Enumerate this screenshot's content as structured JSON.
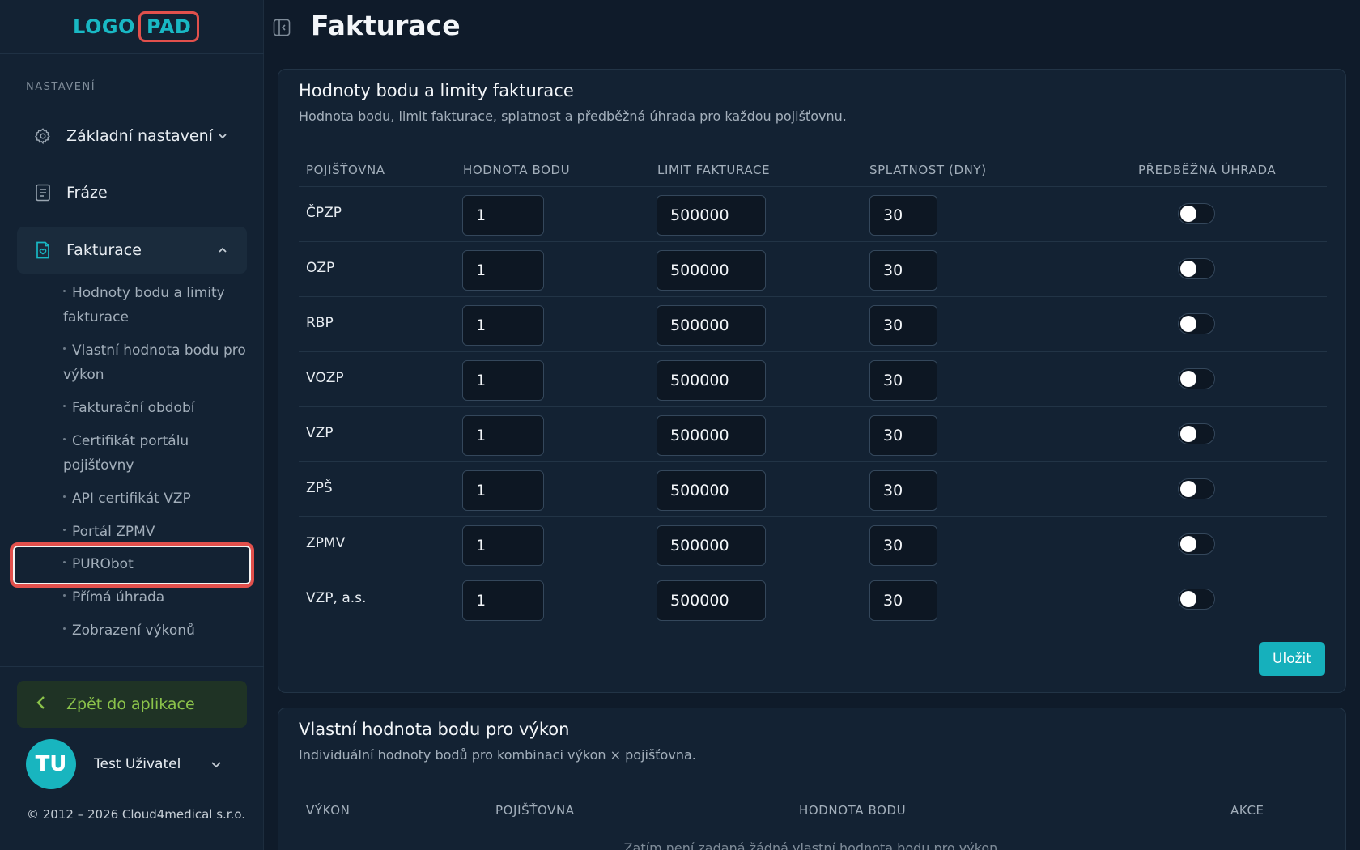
{
  "logo": {
    "left": "LOGO",
    "right": "PAD"
  },
  "sidebar": {
    "section_label": "NASTAVENÍ",
    "items": [
      {
        "label": "Základní nastavení",
        "icon": "gear-icon"
      },
      {
        "label": "Fráze",
        "icon": "document-icon"
      },
      {
        "label": "Fakturace",
        "icon": "invoice-icon"
      }
    ],
    "subitems": [
      "Hodnoty bodu a limity fakturace",
      "Vlastní hodnota bodu pro výkon",
      "Fakturační období",
      "Certifikát portálu pojišťovny",
      "API certifikát VZP",
      "Portál ZPMV",
      "PURObot",
      "Přímá úhrada",
      "Zobrazení výkonů"
    ],
    "back_label": "Zpět do aplikace",
    "user": {
      "initials": "TU",
      "name": "Test Uživatel"
    },
    "copyright": "© 2012 – 2026 Cloud4medical s.r.o."
  },
  "header": {
    "title": "Fakturace"
  },
  "card1": {
    "title": "Hodnoty bodu a limity fakturace",
    "subtitle": "Hodnota bodu, limit fakturace, splatnost a předběžná úhrada pro každou pojišťovnu.",
    "columns": [
      "POJIŠŤOVNA",
      "HODNOTA BODU",
      "LIMIT FAKTURACE",
      "SPLATNOST (DNY)",
      "PŘEDBĚŽNÁ ÚHRADA"
    ],
    "rows": [
      {
        "name": "ČPZP",
        "point": "1",
        "limit": "500000",
        "due": "30",
        "prepay": false
      },
      {
        "name": "OZP",
        "point": "1",
        "limit": "500000",
        "due": "30",
        "prepay": false
      },
      {
        "name": "RBP",
        "point": "1",
        "limit": "500000",
        "due": "30",
        "prepay": false
      },
      {
        "name": "VOZP",
        "point": "1",
        "limit": "500000",
        "due": "30",
        "prepay": false
      },
      {
        "name": "VZP",
        "point": "1",
        "limit": "500000",
        "due": "30",
        "prepay": false
      },
      {
        "name": "ZPŠ",
        "point": "1",
        "limit": "500000",
        "due": "30",
        "prepay": false
      },
      {
        "name": "ZPMV",
        "point": "1",
        "limit": "500000",
        "due": "30",
        "prepay": false
      },
      {
        "name": "VZP, a.s.",
        "point": "1",
        "limit": "500000",
        "due": "30",
        "prepay": false
      }
    ],
    "save_label": "Uložit"
  },
  "card2": {
    "title": "Vlastní hodnota bodu pro výkon",
    "subtitle": "Individuální hodnoty bodů pro kombinaci výkon × pojišťovna.",
    "columns": [
      "VÝKON",
      "POJIŠŤOVNA",
      "HODNOTA BODU",
      "AKCE"
    ],
    "empty_text": "Zatím není zadaná žádná vlastní hodnota bodu pro výkon."
  },
  "colors": {
    "accent": "#16b0bc",
    "highlight": "#e2504c",
    "back": "#8bc34a"
  }
}
